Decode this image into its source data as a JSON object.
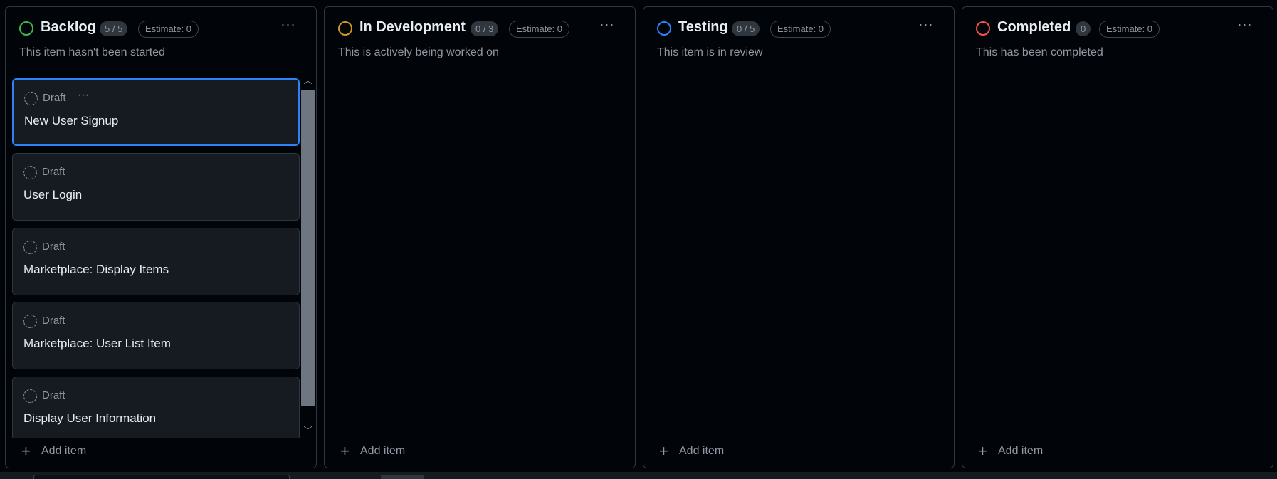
{
  "columns": [
    {
      "title": "Backlog",
      "count": "5 / 5",
      "estimate": "Estimate: 0",
      "description": "This item hasn't been started",
      "status_color": "#3fb950",
      "menu_icon": "more-horizontal-icon",
      "add_label": "Add item",
      "cards": [
        {
          "label": "Draft",
          "title": "New User Signup"
        },
        {
          "label": "Draft",
          "title": "User Login"
        },
        {
          "label": "Draft",
          "title": "Marketplace: Display Items"
        },
        {
          "label": "Draft",
          "title": "Marketplace: User List Item"
        },
        {
          "label": "Draft",
          "title": "Display User Information"
        }
      ]
    },
    {
      "title": "In Development",
      "count": "0 / 3",
      "estimate": "Estimate: 0",
      "description": "This is actively being worked on",
      "status_color": "#d29922",
      "menu_icon": "more-horizontal-icon",
      "add_label": "Add item",
      "cards": []
    },
    {
      "title": "Testing",
      "count": "0 / 5",
      "estimate": "Estimate: 0",
      "description": "This item is in review",
      "status_color": "#2f81f7",
      "menu_icon": "more-horizontal-icon",
      "add_label": "Add item",
      "cards": []
    },
    {
      "title": "Completed",
      "count": "0",
      "estimate": "Estimate: 0",
      "description": "This has been completed",
      "status_color": "#f85149",
      "menu_icon": "more-horizontal-icon",
      "add_label": "Add item",
      "cards": []
    }
  ],
  "glyphs": {
    "menu": "···",
    "plus": "+",
    "scroll_up": "︿",
    "scroll_down": "﹀"
  },
  "colors": {
    "background": "#010409",
    "card_bg": "#161b22",
    "border": "#30363d",
    "selected_border": "#2f81f7",
    "muted_text": "#9198a1"
  }
}
